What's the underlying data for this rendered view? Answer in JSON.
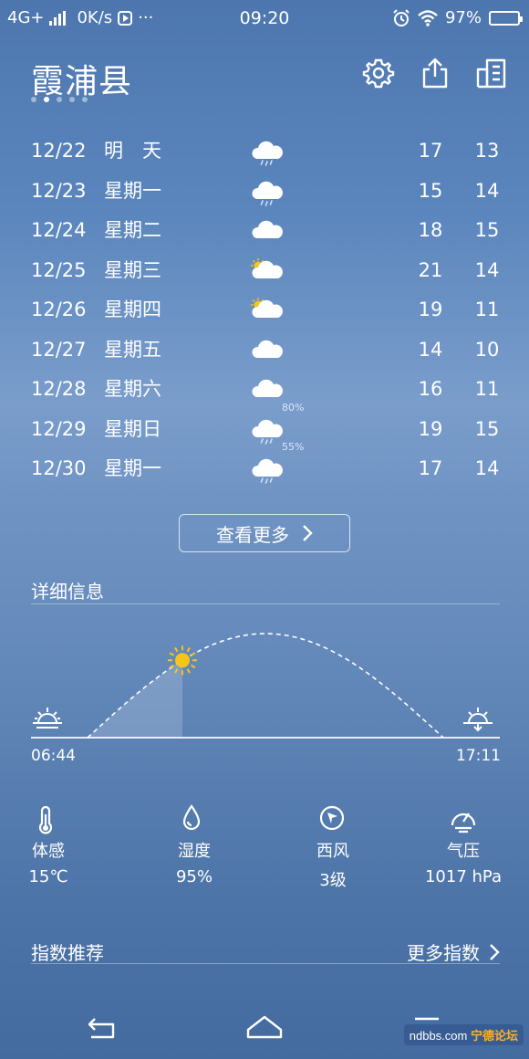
{
  "status_bar": {
    "network": "4G+",
    "speed": "0K/s",
    "time": "09:20",
    "battery": "97%",
    "battery_level": 0.97
  },
  "header": {
    "city": "霞浦县",
    "page_dots": 5,
    "active_dot": 1
  },
  "forecast": [
    {
      "date": "12/22",
      "day": "明　天",
      "icon": "rain-cloud-icon",
      "prob": "",
      "hi": "17",
      "lo": "13"
    },
    {
      "date": "12/23",
      "day": "星期一",
      "icon": "rain-cloud-icon",
      "prob": "",
      "hi": "15",
      "lo": "14"
    },
    {
      "date": "12/24",
      "day": "星期二",
      "icon": "cloud-icon",
      "prob": "",
      "hi": "18",
      "lo": "15"
    },
    {
      "date": "12/25",
      "day": "星期三",
      "icon": "partly-cloudy-icon",
      "prob": "",
      "hi": "21",
      "lo": "14"
    },
    {
      "date": "12/26",
      "day": "星期四",
      "icon": "partly-cloudy-icon",
      "prob": "",
      "hi": "19",
      "lo": "11"
    },
    {
      "date": "12/27",
      "day": "星期五",
      "icon": "cloud-icon",
      "prob": "",
      "hi": "14",
      "lo": "10"
    },
    {
      "date": "12/28",
      "day": "星期六",
      "icon": "cloud-icon",
      "prob": "",
      "hi": "16",
      "lo": "11"
    },
    {
      "date": "12/29",
      "day": "星期日",
      "icon": "rain-cloud-icon",
      "prob": "80%",
      "hi": "19",
      "lo": "15"
    },
    {
      "date": "12/30",
      "day": "星期一",
      "icon": "rain-cloud-icon",
      "prob": "55%",
      "hi": "17",
      "lo": "14"
    }
  ],
  "more_button": "查看更多",
  "details_section": {
    "title": "详细信息",
    "sunrise": "06:44",
    "sunset": "17:11",
    "sun_progress": 0.27
  },
  "details": [
    {
      "label": "体感",
      "value": "15℃",
      "icon": "thermometer-icon"
    },
    {
      "label": "湿度",
      "value": "95%",
      "icon": "drop-icon"
    },
    {
      "label": "西风",
      "value": "3级",
      "icon": "wind-direction-icon"
    },
    {
      "label": "气压",
      "value": "1017 hPa",
      "icon": "gauge-icon"
    }
  ],
  "index_section": {
    "title": "指数推荐",
    "more": "更多指数"
  },
  "watermark": {
    "text": "ndbbs.com",
    "badge": "宁德论坛"
  },
  "colors": {
    "sun": "#f5c518",
    "cloud": "#ffffff",
    "rain": "#cfe0ff"
  }
}
